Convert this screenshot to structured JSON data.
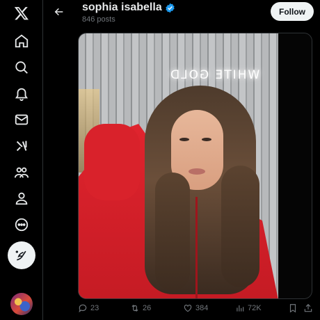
{
  "nav": {
    "items": [
      {
        "name": "x-logo-icon"
      },
      {
        "name": "home-icon"
      },
      {
        "name": "search-icon"
      },
      {
        "name": "notifications-icon"
      },
      {
        "name": "messages-icon"
      },
      {
        "name": "grok-icon"
      },
      {
        "name": "communities-icon"
      },
      {
        "name": "profile-icon"
      },
      {
        "name": "more-icon"
      }
    ],
    "compose_icon": "compose-post-icon"
  },
  "header": {
    "title": "sophia isabella",
    "subtitle": "846 posts",
    "follow_label": "Follow",
    "verified_color": "#1d9bf0"
  },
  "photo": {
    "neon_text": "WHITE GOLD"
  },
  "actions": {
    "replies": "23",
    "reposts": "26",
    "likes": "384",
    "views": "72K"
  },
  "colors": {
    "background": "#000000",
    "text_primary": "#e7e9ea",
    "text_secondary": "#71767b",
    "button_bg": "#eff3f4"
  }
}
